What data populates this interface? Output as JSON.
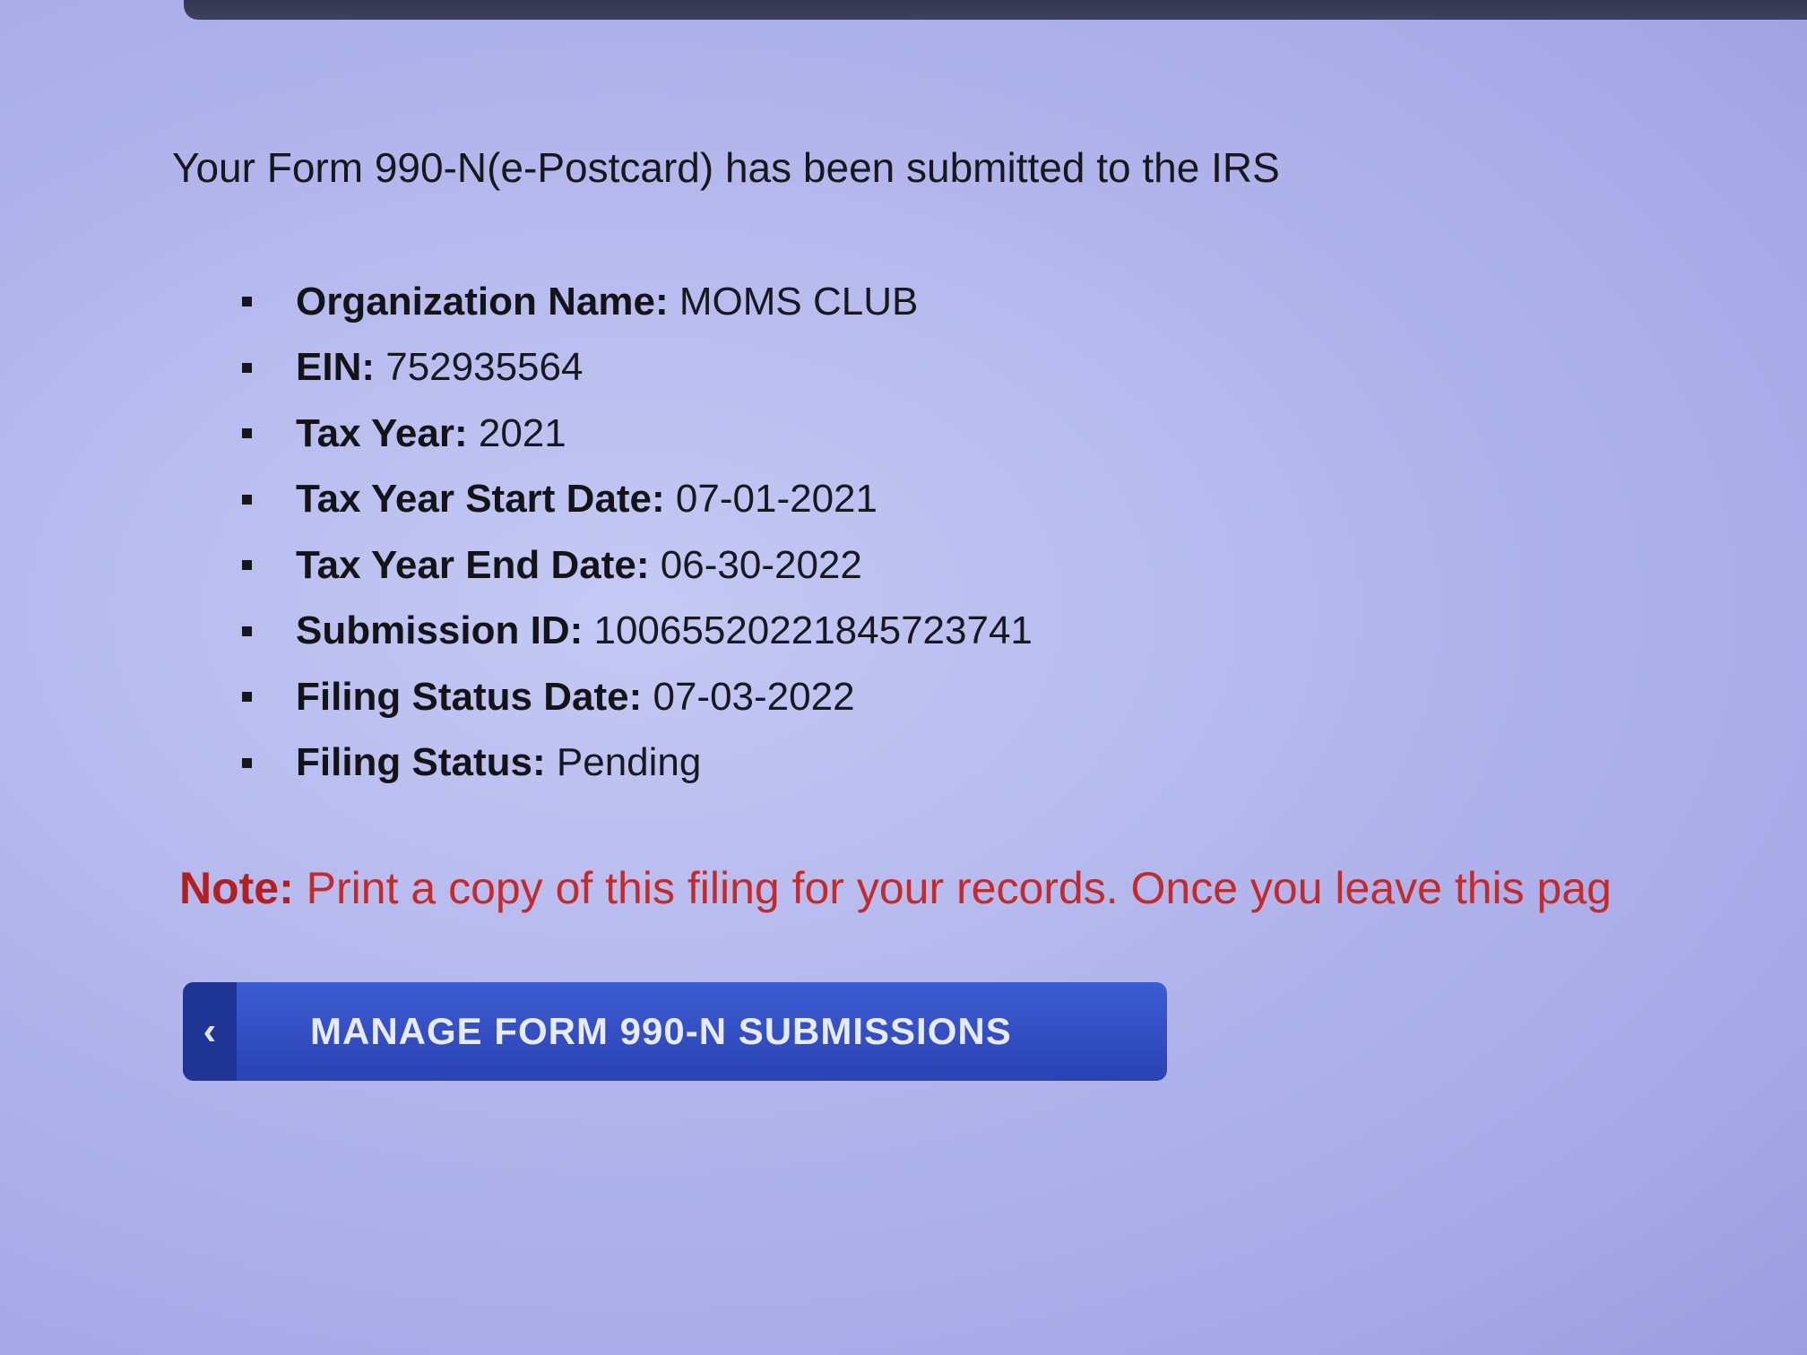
{
  "confirmation": {
    "heading": "Your Form 990-N(e-Postcard) has been submitted to the IRS"
  },
  "details": [
    {
      "label": "Organization Name:",
      "value": "MOMS CLUB"
    },
    {
      "label": "EIN:",
      "value": "752935564"
    },
    {
      "label": "Tax Year:",
      "value": "2021"
    },
    {
      "label": "Tax Year Start Date:",
      "value": "07-01-2021"
    },
    {
      "label": "Tax Year End Date:",
      "value": "06-30-2022"
    },
    {
      "label": "Submission ID:",
      "value": "10065520221845723741"
    },
    {
      "label": "Filing Status Date:",
      "value": "07-03-2022"
    },
    {
      "label": "Filing Status:",
      "value": "Pending"
    }
  ],
  "note": {
    "label": "Note:",
    "text": "Print a copy of this filing for your records. Once you leave this pag"
  },
  "actions": {
    "manage_button": {
      "label": "MANAGE FORM 990-N SUBMISSIONS",
      "icon": "chevron-left-icon"
    }
  }
}
